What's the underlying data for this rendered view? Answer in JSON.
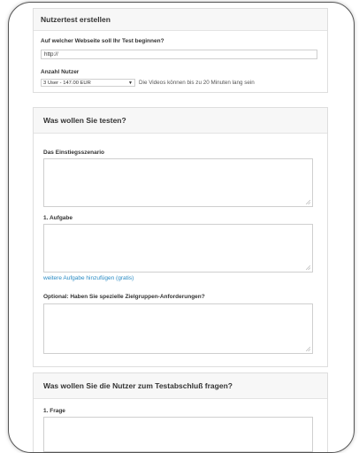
{
  "section1": {
    "title": "Nutzertest erstellen",
    "url_label": "Auf welcher Webseite soll Ihr Test beginnen?",
    "url_value": "http://",
    "users_label": "Anzahl Nutzer",
    "users_selected": "3 User - 147.00 EUR",
    "users_hint": "Die Videos können bis zu 20 Minuten lang sein"
  },
  "section2": {
    "title": "Was wollen Sie testen?",
    "scenario_label": "Das Einstiegsszenario",
    "task_label": "1. Aufgabe",
    "add_task_link": "weitere Aufgabe hinzufügen (gratis)",
    "target_group_label": "Optional: Haben Sie spezielle Zielgruppen-Anforderungen?"
  },
  "section3": {
    "title": "Was wollen Sie die Nutzer zum Testabschluß fragen?",
    "question_label": "1. Frage"
  },
  "icons": {
    "select_arrow": "▼",
    "resize_grip": "resize-grip-icon"
  }
}
